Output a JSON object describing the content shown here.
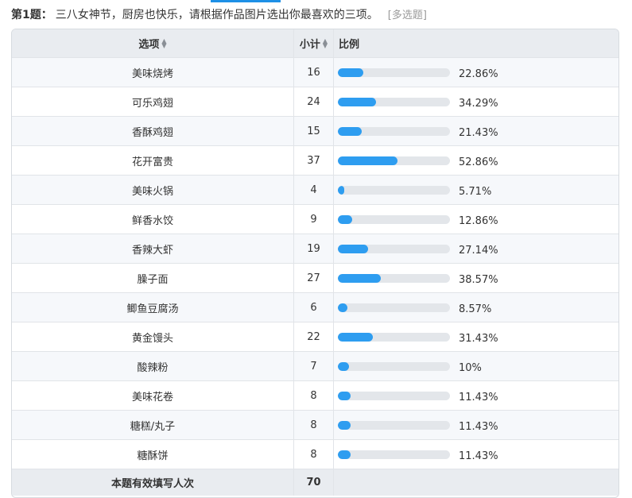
{
  "question": {
    "number": "第1题：",
    "text": "三八女神节，厨房也快乐，请根据作品图片选出你最喜欢的三项。",
    "type": "[多选题]"
  },
  "table": {
    "headers": {
      "option": "选项",
      "count": "小计",
      "ratio": "比例"
    },
    "rows": [
      {
        "option": "美味烧烤",
        "count": "16",
        "percent": "22.86%",
        "ratio": 0.2286
      },
      {
        "option": "可乐鸡翅",
        "count": "24",
        "percent": "34.29%",
        "ratio": 0.3429
      },
      {
        "option": "香酥鸡翅",
        "count": "15",
        "percent": "21.43%",
        "ratio": 0.2143
      },
      {
        "option": "花开富贵",
        "count": "37",
        "percent": "52.86%",
        "ratio": 0.5286
      },
      {
        "option": "美味火锅",
        "count": "4",
        "percent": "5.71%",
        "ratio": 0.0571
      },
      {
        "option": "鲜香水饺",
        "count": "9",
        "percent": "12.86%",
        "ratio": 0.1286
      },
      {
        "option": "香辣大虾",
        "count": "19",
        "percent": "27.14%",
        "ratio": 0.2714
      },
      {
        "option": "臊子面",
        "count": "27",
        "percent": "38.57%",
        "ratio": 0.3857
      },
      {
        "option": "鲫鱼豆腐汤",
        "count": "6",
        "percent": "8.57%",
        "ratio": 0.0857
      },
      {
        "option": "黄金馒头",
        "count": "22",
        "percent": "31.43%",
        "ratio": 0.3143
      },
      {
        "option": "酸辣粉",
        "count": "7",
        "percent": "10%",
        "ratio": 0.1
      },
      {
        "option": "美味花卷",
        "count": "8",
        "percent": "11.43%",
        "ratio": 0.1143
      },
      {
        "option": "糖糕/丸子",
        "count": "8",
        "percent": "11.43%",
        "ratio": 0.1143
      },
      {
        "option": "糖酥饼",
        "count": "8",
        "percent": "11.43%",
        "ratio": 0.1143
      }
    ],
    "footer": {
      "label": "本题有效填写人次",
      "total": "70"
    }
  },
  "colors": {
    "accent": "#2e9df0",
    "header_bg": "#e9ecf0",
    "bar_track": "#e3e6ea"
  },
  "icons": {
    "sort": "sort-updown-icon"
  }
}
